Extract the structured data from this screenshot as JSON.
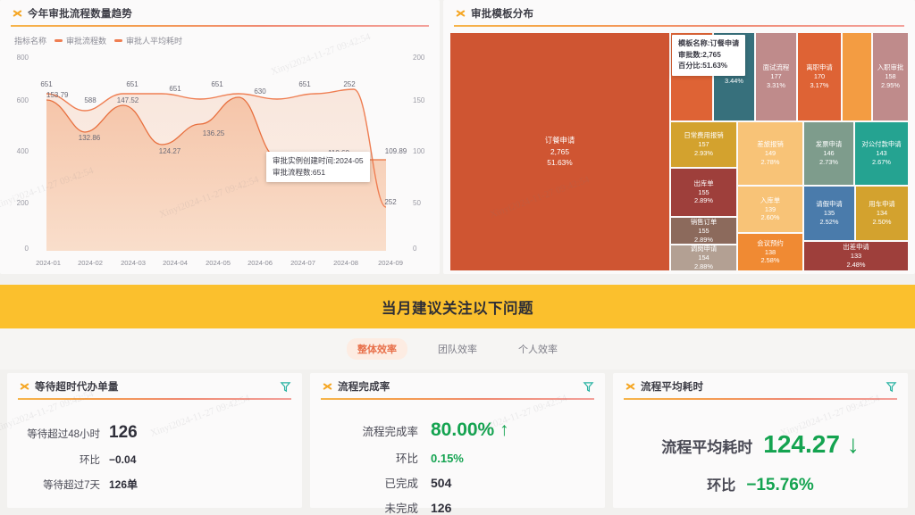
{
  "colors": {
    "accent_orange": "#ef7e52",
    "banner_yellow": "#fbc02d",
    "green": "#14a350",
    "tab_active_bg": "#fdece2",
    "tab_active_text": "#e8704a"
  },
  "trend_card": {
    "title": "今年审批流程数量趋势",
    "icon": "x-icon",
    "filter_icon": "filter-icon"
  },
  "treemap_card": {
    "title": "审批模板分布",
    "icon": "x-icon",
    "tooltip": {
      "line1": "模板名称:订餐申请",
      "line2": "审批数:2,765",
      "line3": "百分比:51.63%"
    }
  },
  "banner": {
    "text": "当月建议关注以下问题"
  },
  "tabs": [
    {
      "label": "整体效率",
      "active": true
    },
    {
      "label": "团队效率",
      "active": false
    },
    {
      "label": "个人效率",
      "active": false
    }
  ],
  "kpi_cards": [
    {
      "title": "等待超时代办单量",
      "icon": "x-icon",
      "rows": [
        {
          "label": "等待超过48小时",
          "value": "126",
          "style": "big"
        },
        {
          "label": "环比",
          "value": "−0.04",
          "style": "normal"
        },
        {
          "label": "等待超过7天",
          "value": "126单",
          "style": "normal"
        }
      ]
    },
    {
      "title": "流程完成率",
      "icon": "x-icon",
      "rows": [
        {
          "label": "流程完成率",
          "value": "80.00% ↑",
          "style": "hero"
        },
        {
          "label": "环比",
          "value": "0.15%",
          "style": "green"
        },
        {
          "label": "已完成",
          "value": "504",
          "style": "dark"
        },
        {
          "label": "未完成",
          "value": "126",
          "style": "dark"
        }
      ]
    },
    {
      "title": "流程平均耗时",
      "icon": "x-icon",
      "center": {
        "label1": "流程平均耗时",
        "value1": "124.27 ↓",
        "label2": "环比",
        "value2": "−15.76%"
      }
    }
  ],
  "chart_data": {
    "type": "line",
    "title": "今年审批流程数量趋势",
    "legend_prefix": "指标名称",
    "legend": [
      "审批流程数",
      "审批人平均耗时"
    ],
    "legend_position": "top-left",
    "grid": false,
    "x": [
      "2024-01",
      "2024-02",
      "2024-03",
      "2024-04",
      "2024-05",
      "2024-06",
      "2024-07",
      "2024-08",
      "2024-09"
    ],
    "xlabel": "",
    "y_left": {
      "label": "审批流程数",
      "ylim": [
        0,
        800
      ],
      "ticks": [
        0,
        200,
        400,
        600,
        800
      ]
    },
    "y_right": {
      "label": "审批人平均耗时",
      "ylim": [
        0,
        200
      ],
      "ticks": [
        0,
        50,
        100,
        150,
        200
      ]
    },
    "series": [
      {
        "name": "审批流程数",
        "axis": "left",
        "color": "#ef7e52",
        "values": [
          651,
          588,
          651,
          651,
          630,
          651,
          630,
          651,
          252
        ],
        "labels": [
          "651",
          "588",
          "651",
          "651",
          "630",
          "651",
          "630",
          "651",
          "252"
        ]
      },
      {
        "name": "审批人平均耗时",
        "axis": "right",
        "color": "#ef9a72",
        "values": [
          153.79,
          132.86,
          147.52,
          124.27,
          136.25,
          136.25,
          110.6,
          110.6,
          109.89
        ],
        "labels": [
          "153.79",
          "132.86",
          "147.52",
          "124.27",
          "136.25",
          "",
          "110.60",
          "",
          "109.89"
        ]
      }
    ],
    "tooltip": {
      "line1": "审批实例创建时间:2024-05",
      "line2": "审批流程数:651"
    }
  },
  "treemap_data": {
    "type": "treemap",
    "title": "审批模板分布",
    "tiles": [
      {
        "name": "订餐申请",
        "value": "2,765",
        "pct": "51.63%",
        "color": "#cf5532"
      },
      {
        "name": "",
        "value": "184",
        "pct": "3.44%",
        "color": "#37707c"
      },
      {
        "name": "面试流程",
        "value": "177",
        "pct": "3.31%",
        "color": "#bf8b8b"
      },
      {
        "name": "离职申请",
        "value": "170",
        "pct": "3.17%",
        "color": "#de6335"
      },
      {
        "name": "",
        "value": "",
        "pct": "",
        "color": "#f39c42"
      },
      {
        "name": "入职审批",
        "value": "158",
        "pct": "2.95%",
        "color": "#bf8b8b"
      },
      {
        "name": "日常费用报销",
        "value": "157",
        "pct": "2.93%",
        "color": "#d3a22e"
      },
      {
        "name": "差旅报销",
        "value": "149",
        "pct": "2.78%",
        "color": "#f8c377"
      },
      {
        "name": "发票申请",
        "value": "146",
        "pct": "2.73%",
        "color": "#7e9c8c"
      },
      {
        "name": "对公付款申请",
        "value": "143",
        "pct": "2.67%",
        "color": "#25a391"
      },
      {
        "name": "出库单",
        "value": "155",
        "pct": "2.89%",
        "color": "#9e3f3b"
      },
      {
        "name": "销售订单",
        "value": "155",
        "pct": "2.89%",
        "color": "#8c6a5c"
      },
      {
        "name": "调岗申请",
        "value": "154",
        "pct": "2.88%",
        "color": "#b3a093"
      },
      {
        "name": "入库单",
        "value": "139",
        "pct": "2.60%",
        "color": "#f8c377"
      },
      {
        "name": "会议预约",
        "value": "138",
        "pct": "2.58%",
        "color": "#f08a33"
      },
      {
        "name": "请假申请",
        "value": "135",
        "pct": "2.52%",
        "color": "#4a7bab"
      },
      {
        "name": "用车申请",
        "value": "134",
        "pct": "2.50%",
        "color": "#d3a22e"
      },
      {
        "name": "出差申请",
        "value": "133",
        "pct": "2.48%",
        "color": "#9e3f3b"
      }
    ]
  },
  "watermarks": [
    "Xinyi2024-11-27 09:42:54",
    "Xinyi2024-11-27 09:42:54",
    "Xinyi2024-11-27 09:42:54",
    "Xinyi2024-11-27 09:42:54",
    "Xinyi2024-11-27 09:42:54",
    "Xinyi2024-11-27 09:42:54",
    "Xinyi2024-11-27 09:42:54",
    "Xinyi2024-11-27 09:42:54"
  ]
}
